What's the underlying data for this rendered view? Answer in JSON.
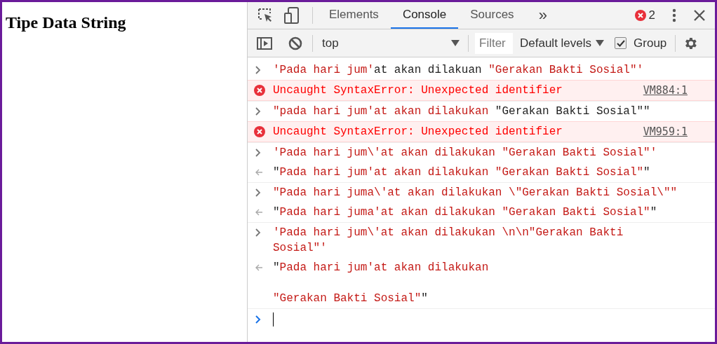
{
  "page": {
    "heading": "Tipe Data String"
  },
  "devtools": {
    "tabs": [
      {
        "label": "Elements",
        "selected": false
      },
      {
        "label": "Console",
        "selected": true
      },
      {
        "label": "Sources",
        "selected": false
      }
    ],
    "more_tabs": "»",
    "error_count": "2",
    "console_toolbar": {
      "context": "top",
      "filter_placeholder": "Filter",
      "levels": "Default levels",
      "group": {
        "label": "Group",
        "checked": true
      }
    },
    "entries": [
      {
        "kind": "input",
        "segments": [
          {
            "text": "'Pada hari jum'",
            "color": "#c41a16"
          },
          {
            "text": "at akan dilakuan ",
            "color": "#222222"
          },
          {
            "text": "\"Gerakan Bakti Sosial\"'",
            "color": "#c41a16"
          }
        ]
      },
      {
        "kind": "error",
        "message": "Uncaught SyntaxError: Unexpected identifier",
        "source": "VM884:1"
      },
      {
        "kind": "input",
        "segments": [
          {
            "text": "\"pada hari jum'at akan dilakukan ",
            "color": "#c41a16"
          },
          {
            "text": "\"Gerakan Bakti Sosial\"\"",
            "color": "#222222"
          }
        ]
      },
      {
        "kind": "error",
        "message": "Uncaught SyntaxError: Unexpected identifier",
        "source": "VM959:1"
      },
      {
        "kind": "input",
        "segments": [
          {
            "text": "'Pada hari jum\\'at akan dilakukan \"Gerakan Bakti Sosial\"'",
            "color": "#c41a16"
          }
        ]
      },
      {
        "kind": "result",
        "segments": [
          {
            "text": "\"",
            "color": "#222222"
          },
          {
            "text": "Pada hari jum'at akan dilakukan \"Gerakan Bakti Sosial\"",
            "color": "#c41a16"
          },
          {
            "text": "\"",
            "color": "#222222"
          }
        ]
      },
      {
        "kind": "input",
        "segments": [
          {
            "text": "\"Pada hari juma\\'at akan dilakukan \\\"Gerakan Bakti Sosial\\\"\"",
            "color": "#c41a16"
          }
        ]
      },
      {
        "kind": "result",
        "segments": [
          {
            "text": "\"",
            "color": "#222222"
          },
          {
            "text": "Pada hari juma'at akan dilakukan \"Gerakan Bakti Sosial\"",
            "color": "#c41a16"
          },
          {
            "text": "\"",
            "color": "#222222"
          }
        ]
      },
      {
        "kind": "input",
        "segments": [
          {
            "text": "'Pada hari jum\\'at akan dilakukan \\n\\n\"Gerakan Bakti Sosial\"'",
            "color": "#c41a16"
          }
        ]
      },
      {
        "kind": "result",
        "segments": [
          {
            "text": "\"",
            "color": "#222222"
          },
          {
            "text": "Pada hari jum'at akan dilakukan \n\n\"Gerakan Bakti Sosial\"",
            "color": "#c41a16"
          },
          {
            "text": "\"",
            "color": "#222222"
          }
        ]
      }
    ]
  }
}
